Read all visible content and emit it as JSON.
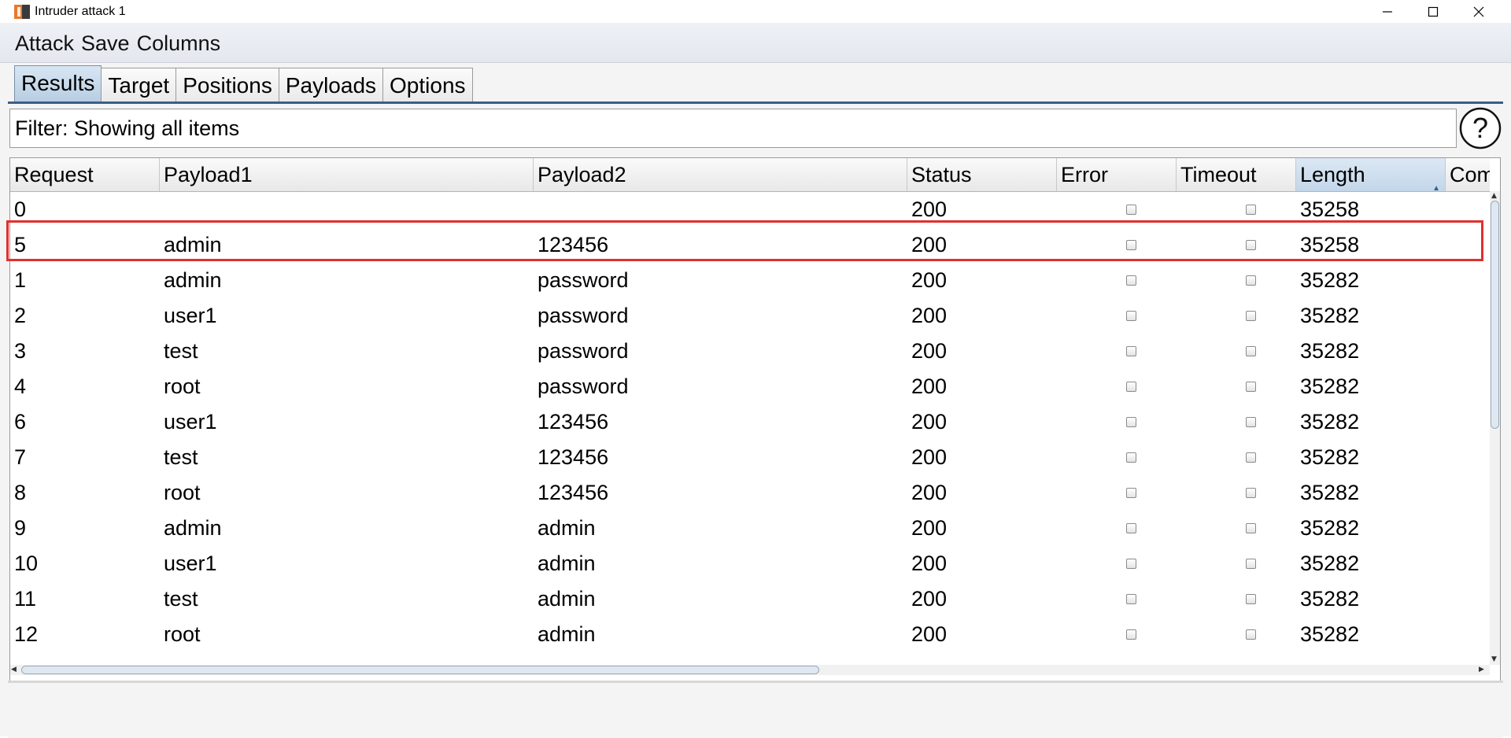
{
  "window": {
    "title": "Intruder attack 1",
    "controls": [
      "minimize-icon",
      "maximize-icon",
      "close-icon"
    ]
  },
  "menu": {
    "items": [
      "Attack",
      "Save",
      "Columns"
    ]
  },
  "tabs": [
    {
      "label": "Results",
      "active": true
    },
    {
      "label": "Target",
      "active": false
    },
    {
      "label": "Positions",
      "active": false
    },
    {
      "label": "Payloads",
      "active": false
    },
    {
      "label": "Options",
      "active": false
    }
  ],
  "filter": {
    "label": "Filter: Showing all items",
    "help_icon": "question-circle-icon"
  },
  "table": {
    "columns": [
      "Request",
      "Payload1",
      "Payload2",
      "Status",
      "Error",
      "Timeout",
      "Length",
      "Com"
    ],
    "sorted_column": "Length",
    "rows": [
      {
        "request": "0",
        "payload1": "",
        "payload2": "",
        "status": "200",
        "error": false,
        "timeout": false,
        "length": "35258"
      },
      {
        "request": "5",
        "payload1": "admin",
        "payload2": "123456",
        "status": "200",
        "error": false,
        "timeout": false,
        "length": "35258",
        "highlighted": true
      },
      {
        "request": "1",
        "payload1": "admin",
        "payload2": "password",
        "status": "200",
        "error": false,
        "timeout": false,
        "length": "35282"
      },
      {
        "request": "2",
        "payload1": "user1",
        "payload2": "password",
        "status": "200",
        "error": false,
        "timeout": false,
        "length": "35282"
      },
      {
        "request": "3",
        "payload1": "test",
        "payload2": "password",
        "status": "200",
        "error": false,
        "timeout": false,
        "length": "35282"
      },
      {
        "request": "4",
        "payload1": "root",
        "payload2": "password",
        "status": "200",
        "error": false,
        "timeout": false,
        "length": "35282"
      },
      {
        "request": "6",
        "payload1": "user1",
        "payload2": "123456",
        "status": "200",
        "error": false,
        "timeout": false,
        "length": "35282"
      },
      {
        "request": "7",
        "payload1": "test",
        "payload2": "123456",
        "status": "200",
        "error": false,
        "timeout": false,
        "length": "35282"
      },
      {
        "request": "8",
        "payload1": "root",
        "payload2": "123456",
        "status": "200",
        "error": false,
        "timeout": false,
        "length": "35282"
      },
      {
        "request": "9",
        "payload1": "admin",
        "payload2": "admin",
        "status": "200",
        "error": false,
        "timeout": false,
        "length": "35282"
      },
      {
        "request": "10",
        "payload1": "user1",
        "payload2": "admin",
        "status": "200",
        "error": false,
        "timeout": false,
        "length": "35282"
      },
      {
        "request": "11",
        "payload1": "test",
        "payload2": "admin",
        "status": "200",
        "error": false,
        "timeout": false,
        "length": "35282"
      },
      {
        "request": "12",
        "payload1": "root",
        "payload2": "admin",
        "status": "200",
        "error": false,
        "timeout": false,
        "length": "35282"
      }
    ]
  },
  "colors": {
    "active_tab": "#b7cde3",
    "tab_underline": "#3b5e86",
    "highlight_border": "#e0312f"
  }
}
